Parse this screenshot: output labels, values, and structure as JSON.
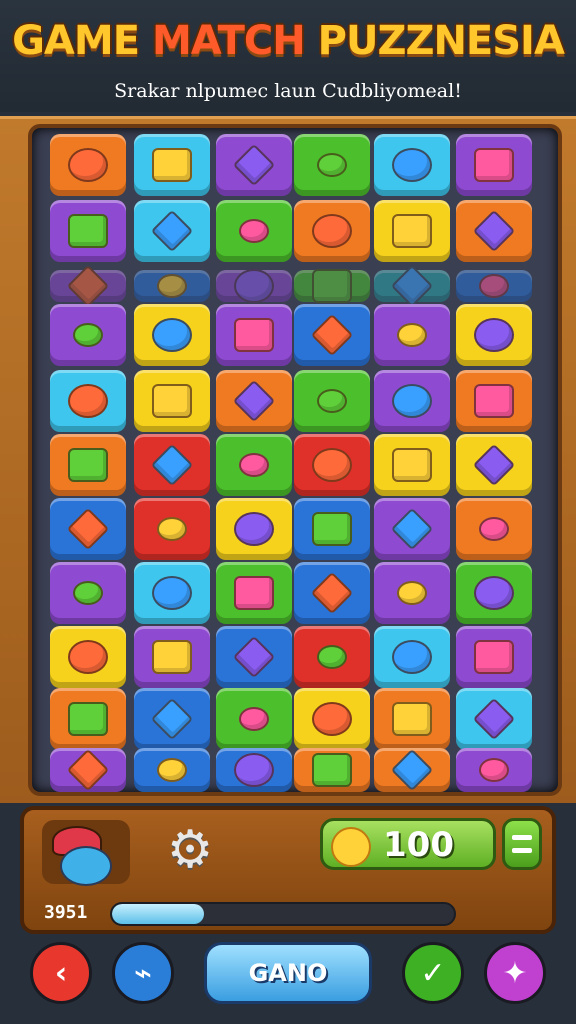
{
  "header": {
    "title_part1": "GAME ",
    "title_part2": "MATCH",
    "title_part3": " PUZZNESIA",
    "subtitle": "Srakar nlpumec  laun Cudbliyomeal!"
  },
  "board": {
    "palette": {
      "orange": "#f07a22",
      "cyan": "#3ec6ee",
      "purple": "#8e4ad0",
      "green": "#4cc02c",
      "yellow": "#f6d21c",
      "blue": "#2a74d8",
      "red": "#e0302a",
      "teal": "#2aa8b0"
    },
    "rows": [
      [
        {
          "c": "orange",
          "icon": "creature-icon"
        },
        {
          "c": "cyan",
          "icon": "blob-icon"
        },
        {
          "c": "purple",
          "icon": "cube-icon"
        },
        {
          "c": "green",
          "icon": "bottle-icon"
        },
        {
          "c": "cyan",
          "icon": "apple-icon"
        },
        {
          "c": "purple",
          "icon": "monster-icon"
        }
      ],
      [
        {
          "c": "purple",
          "icon": "star-icon"
        },
        {
          "c": "cyan",
          "icon": "chest-icon"
        },
        {
          "c": "green",
          "icon": "cross-icon"
        },
        {
          "c": "orange",
          "icon": "bag-icon"
        },
        {
          "c": "yellow",
          "icon": "cloud-icon"
        },
        {
          "c": "orange",
          "icon": "rock-icon"
        }
      ],
      [
        {
          "c": "purple",
          "icon": "leaf-icon"
        },
        {
          "c": "blue",
          "icon": "crab-icon"
        },
        {
          "c": "purple",
          "icon": "bag-icon"
        },
        {
          "c": "green",
          "icon": "log-icon"
        },
        {
          "c": "teal",
          "icon": "fish-icon"
        },
        {
          "c": "blue",
          "icon": "gem-icon"
        }
      ],
      [
        {
          "c": "purple",
          "icon": "wing-icon"
        },
        {
          "c": "yellow",
          "icon": "leaf-icon"
        },
        {
          "c": "purple",
          "icon": "donut-icon"
        },
        {
          "c": "blue",
          "icon": "heart-icon"
        },
        {
          "c": "purple",
          "icon": "sun-icon"
        },
        {
          "c": "yellow",
          "icon": "bird-icon"
        }
      ],
      [
        {
          "c": "cyan",
          "icon": "duck-icon"
        },
        {
          "c": "yellow",
          "icon": "slime-icon"
        },
        {
          "c": "orange",
          "icon": "orb-icon"
        },
        {
          "c": "green",
          "icon": "spike-icon"
        },
        {
          "c": "purple",
          "icon": "fish-icon"
        },
        {
          "c": "orange",
          "icon": "berry-icon"
        }
      ],
      [
        {
          "c": "orange",
          "icon": "bear-icon"
        },
        {
          "c": "red",
          "icon": "fruit-icon"
        },
        {
          "c": "green",
          "icon": "ball-icon"
        },
        {
          "c": "red",
          "icon": "box-icon"
        },
        {
          "c": "yellow",
          "icon": "chest-icon"
        },
        {
          "c": "yellow",
          "icon": "orb-icon"
        }
      ],
      [
        {
          "c": "blue",
          "icon": "monster-icon"
        },
        {
          "c": "red",
          "icon": "ufo-icon"
        },
        {
          "c": "yellow",
          "icon": "bones-icon"
        },
        {
          "c": "blue",
          "icon": "bag-icon"
        },
        {
          "c": "purple",
          "icon": "cat-icon"
        },
        {
          "c": "orange",
          "icon": "heart-icon"
        }
      ],
      [
        {
          "c": "purple",
          "icon": "fairy-icon"
        },
        {
          "c": "cyan",
          "icon": "bus-icon"
        },
        {
          "c": "green",
          "icon": "flower-icon"
        },
        {
          "c": "blue",
          "icon": "crab-icon"
        },
        {
          "c": "purple",
          "icon": "smile-icon"
        },
        {
          "c": "green",
          "icon": "face-icon"
        }
      ],
      [
        {
          "c": "yellow",
          "icon": "apple-icon"
        },
        {
          "c": "purple",
          "icon": "plane-icon"
        },
        {
          "c": "blue",
          "icon": "flower-icon"
        },
        {
          "c": "red",
          "icon": "splat-icon"
        },
        {
          "c": "cyan",
          "icon": "sword-icon"
        },
        {
          "c": "purple",
          "icon": "heart-icon"
        }
      ],
      [
        {
          "c": "orange",
          "icon": "lizard-icon"
        },
        {
          "c": "blue",
          "icon": "face-icon"
        },
        {
          "c": "green",
          "icon": "face-icon"
        },
        {
          "c": "yellow",
          "icon": "orb-icon"
        },
        {
          "c": "orange",
          "icon": "shell-icon"
        },
        {
          "c": "cyan",
          "icon": "duck-icon"
        }
      ],
      [
        {
          "c": "purple",
          "icon": "lizard-icon"
        },
        {
          "c": "blue",
          "icon": "slime-icon"
        },
        {
          "c": "blue",
          "icon": "horn-icon"
        },
        {
          "c": "orange",
          "icon": "box-icon"
        },
        {
          "c": "orange",
          "icon": "fruit-icon"
        },
        {
          "c": "purple",
          "icon": "bird-icon"
        }
      ]
    ]
  },
  "panel": {
    "avatar_icon": "hero-icon",
    "settings_icon": "gear-icon",
    "score_icon": "sun-coin-icon",
    "score": "100",
    "menu_icon": "menu-icon",
    "level_label": "3951",
    "progress": 0.27
  },
  "controls": {
    "back_icon": "back-arrow-icon",
    "back_color": "#e8382e",
    "link_icon": "link-icon",
    "link_color": "#2a7ed8",
    "go_label": "GANO",
    "check_icon": "check-icon",
    "check_color": "#3eb024",
    "magic_icon": "magic-icon",
    "magic_color": "#c040d0"
  }
}
